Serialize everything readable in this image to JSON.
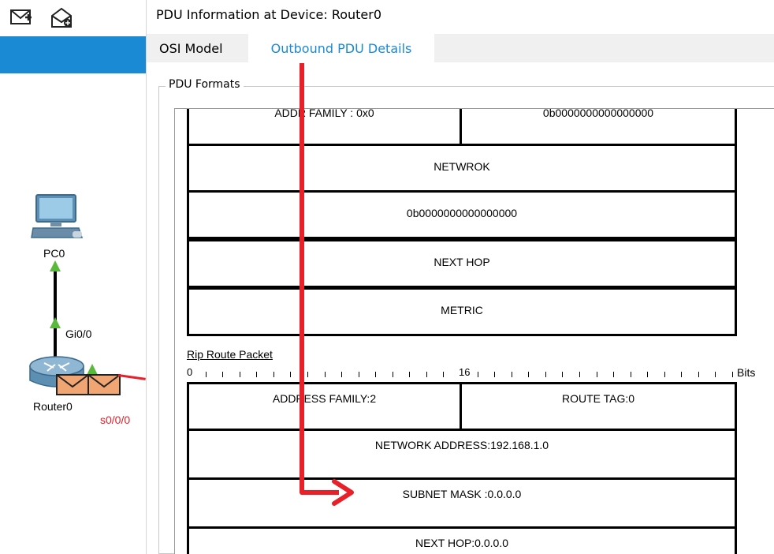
{
  "workspace": {
    "devices": [
      {
        "name": "PC0",
        "icon": "pc-icon"
      },
      {
        "name": "Router0",
        "icon": "router-icon"
      }
    ],
    "ports": {
      "gi": "Gi0/0",
      "serial": "s0/0/0"
    },
    "toolbar": {
      "icons": [
        "inspect-envelope-icon",
        "add-envelope-icon"
      ]
    }
  },
  "dialog": {
    "title": "PDU Information at Device: Router0",
    "tabs": [
      {
        "label": "OSI Model",
        "active": false
      },
      {
        "label": "Outbound PDU Details",
        "active": true
      }
    ],
    "group_label": "PDU Formats"
  },
  "top_table": {
    "rows": [
      {
        "cells": [
          "ADDR FAMILY : 0x0",
          "0b0000000000000000"
        ]
      },
      {
        "cells": [
          "NETWROK"
        ]
      },
      {
        "cells": [
          "0b0000000000000000"
        ]
      },
      {
        "cells": [
          "NEXT HOP"
        ]
      },
      {
        "cells": [
          "METRIC"
        ]
      }
    ]
  },
  "rip_packet": {
    "title": "Rip Route Packet",
    "ruler": {
      "start": "0",
      "mid": "16",
      "unit": "Bits"
    },
    "rows": [
      {
        "cells": [
          "ADDRESS FAMILY:2",
          "ROUTE TAG:0"
        ]
      },
      {
        "cells": [
          "NETWORK ADDRESS:192.168.1.0"
        ]
      },
      {
        "cells": [
          "SUBNET MASK :0.0.0.0"
        ]
      },
      {
        "cells": [
          "NEXT HOP:0.0.0.0"
        ]
      }
    ]
  },
  "colors": {
    "accent": "#1a8ad5",
    "annotation_arrow": "#e8202a",
    "link_arrow": "#58b93a"
  }
}
